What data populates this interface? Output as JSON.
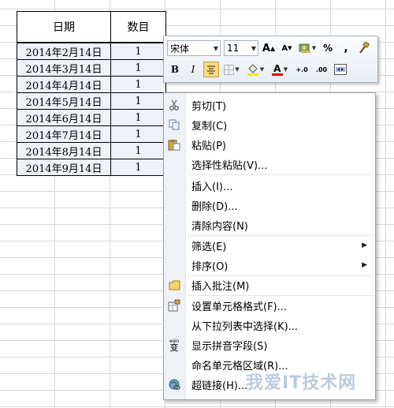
{
  "sheet": {
    "headers": [
      "日期",
      "数目"
    ],
    "rows": [
      [
        "2014年2月14日",
        "1"
      ],
      [
        "2014年3月14日",
        "1"
      ],
      [
        "2014年4月14日",
        "1"
      ],
      [
        "2014年5月14日",
        "1"
      ],
      [
        "2014年6月14日",
        "1"
      ],
      [
        "2014年7月14日",
        "1"
      ],
      [
        "2014年8月14日",
        "1"
      ],
      [
        "2014年9月14日",
        "1"
      ]
    ]
  },
  "mini_toolbar": {
    "font_name": "宋体",
    "font_size": "11",
    "grow": "A",
    "shrink": "A",
    "percent": "%",
    "comma": ",",
    "bold": "B",
    "italic": "I",
    "font_color_letter": "A",
    "inc_decimal": "+.0",
    "dec_decimal": ".00",
    "accent_fill": "#ffe600",
    "accent_font": "#e00000"
  },
  "context_menu": {
    "items": [
      {
        "label": "剪切(T)",
        "icon": "scissors-icon"
      },
      {
        "label": "复制(C)",
        "icon": "copy-icon"
      },
      {
        "label": "粘贴(P)",
        "icon": "paste-icon"
      },
      {
        "label": "选择性粘贴(V)...",
        "icon": ""
      },
      {
        "label": "插入(I)...",
        "icon": ""
      },
      {
        "label": "删除(D)...",
        "icon": ""
      },
      {
        "label": "清除内容(N)",
        "icon": ""
      },
      {
        "label": "筛选(E)",
        "icon": "",
        "submenu": true
      },
      {
        "label": "排序(O)",
        "icon": "",
        "submenu": true
      },
      {
        "label": "插入批注(M)",
        "icon": "comment-icon"
      },
      {
        "label": "设置单元格格式(F)...",
        "icon": "format-cells-icon"
      },
      {
        "label": "从下拉列表中选择(K)...",
        "icon": ""
      },
      {
        "label": "显示拼音字段(S)",
        "icon": "phonetic-icon"
      },
      {
        "label": "命名单元格区域(R)...",
        "icon": ""
      },
      {
        "label": "超链接(H)...",
        "icon": "hyperlink-icon"
      }
    ],
    "phonetic_glyph": "wén",
    "phonetic_char": "变"
  },
  "watermark": {
    "text": "我爱IT技术网"
  }
}
